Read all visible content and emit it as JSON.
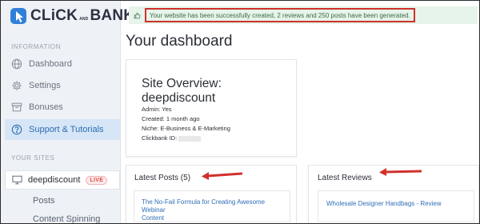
{
  "logo": {
    "main_left": "CLiCK",
    "and": "AND",
    "main_right": "BANK",
    "sup": "x"
  },
  "sidebar": {
    "section_information": "INFORMATION",
    "items": [
      {
        "label": "Dashboard",
        "icon": "globe-icon"
      },
      {
        "label": "Settings",
        "icon": "gear-icon"
      },
      {
        "label": "Bonuses",
        "icon": "archive-icon"
      },
      {
        "label": "Support & Tutorials",
        "icon": "help-circle-icon",
        "active": true
      }
    ],
    "section_sites": "YOUR SITES",
    "site": {
      "name": "deepdiscount",
      "badge": "LIVE",
      "icon": "monitor-icon"
    },
    "sub_items": [
      "Posts",
      "Content Spinning"
    ]
  },
  "alert": {
    "icon": "thumbs-up-icon",
    "text": "Your website has been successfully created, 2 reviews and 250 posts have been generated."
  },
  "page_title": "Your dashboard",
  "overview": {
    "title_line1": "Site Overview:",
    "title_line2": "deepdiscount",
    "admin": "Admin: Yes",
    "created": "Created: 1 month ago",
    "niche": "Niche: E-Business & E-Marketing",
    "clickbank": "Clickbank ID:"
  },
  "latest_posts": {
    "heading": "Latest Posts (5)",
    "first_item_line1": "The No-Fail Formula for Creating Awesome Webinar",
    "first_item_line2": "Content"
  },
  "latest_reviews": {
    "heading": "Latest Reviews",
    "first_item": "Wholesale Designer Handbags - Review"
  },
  "colors": {
    "accent_red": "#d0312d",
    "link_blue": "#2f6fb7",
    "alert_bg": "#e6f4ea",
    "active_nav_bg": "#d6e6f7"
  }
}
